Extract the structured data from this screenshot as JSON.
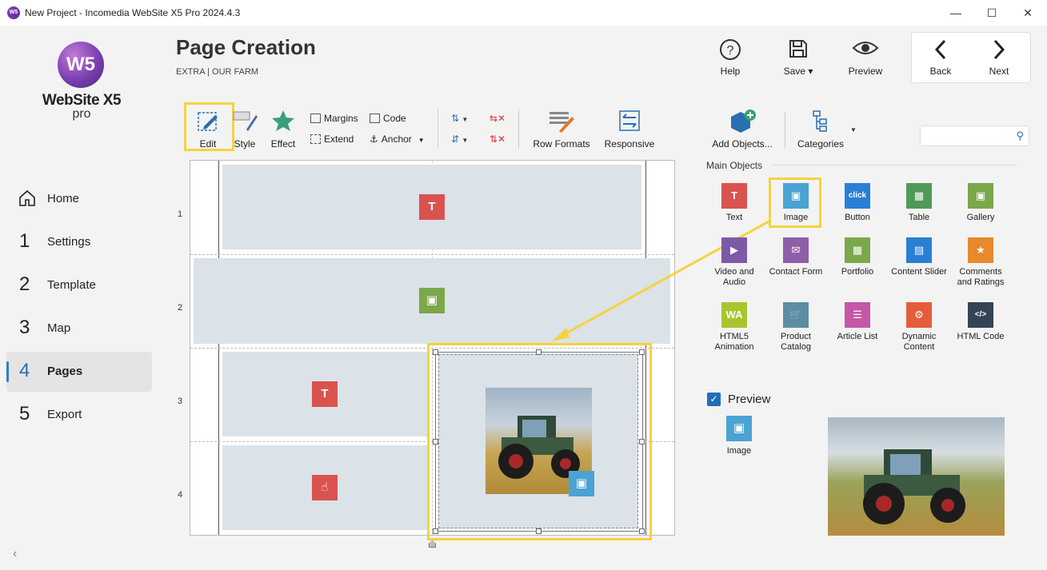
{
  "window": {
    "title": "New Project - Incomedia WebSite X5 Pro 2024.4.3",
    "minimize": "—",
    "maximize": "☐",
    "close": "✕"
  },
  "logo": {
    "mark": "W5",
    "name": "WebSite X5",
    "edition": "pro"
  },
  "nav": {
    "home": "Home",
    "steps": [
      {
        "num": "1",
        "label": "Settings"
      },
      {
        "num": "2",
        "label": "Template"
      },
      {
        "num": "3",
        "label": "Map"
      },
      {
        "num": "4",
        "label": "Pages"
      },
      {
        "num": "5",
        "label": "Export"
      }
    ],
    "collapse": "‹"
  },
  "header": {
    "title": "Page Creation",
    "breadcrumb": "EXTRA | OUR FARM",
    "help": "Help",
    "save": "Save ▾",
    "preview": "Preview",
    "back": "Back",
    "next": "Next"
  },
  "ribbon": {
    "edit": "Edit",
    "style": "Style",
    "effect": "Effect",
    "margins": "Margins",
    "extend": "Extend",
    "code": "Code",
    "anchor": "Anchor",
    "row_formats": "Row Formats",
    "responsive": "Responsive",
    "add_objects": "Add Objects...",
    "categories": "Categories"
  },
  "grid": {
    "rows": [
      "1",
      "2",
      "3",
      "4"
    ]
  },
  "objects": {
    "section_title": "Main Objects",
    "items": [
      {
        "label": "Text",
        "glyph": "T",
        "color": "#d9534f"
      },
      {
        "label": "Image",
        "glyph": "▣",
        "color": "#4aa3d4"
      },
      {
        "label": "Button",
        "glyph": "click",
        "color": "#2a7fd4"
      },
      {
        "label": "Table",
        "glyph": "▦",
        "color": "#4f9a58"
      },
      {
        "label": "Gallery",
        "glyph": "▣",
        "color": "#7aa84a"
      },
      {
        "label": "Video and Audio",
        "glyph": "▶",
        "color": "#7b5aa6"
      },
      {
        "label": "Contact Form",
        "glyph": "✉",
        "color": "#8e5fa8"
      },
      {
        "label": "Portfolio",
        "glyph": "▦",
        "color": "#7aa84a"
      },
      {
        "label": "Content Slider",
        "glyph": "▤",
        "color": "#2a7fd4"
      },
      {
        "label": "Comments and Ratings",
        "glyph": "★",
        "color": "#e8892b"
      },
      {
        "label": "HTML5 Animation",
        "glyph": "WA",
        "color": "#a8c52e"
      },
      {
        "label": "Product Catalog",
        "glyph": "🛒",
        "color": "#5b8ea3"
      },
      {
        "label": "Article List",
        "glyph": "☰",
        "color": "#c557a8"
      },
      {
        "label": "Dynamic Content",
        "glyph": "⚙",
        "color": "#e35d3c"
      },
      {
        "label": "HTML Code",
        "glyph": "</>",
        "color": "#334455"
      }
    ]
  },
  "preview": {
    "label": "Preview",
    "checked": "✓",
    "object_label": "Image"
  },
  "search": {
    "placeholder": ""
  }
}
